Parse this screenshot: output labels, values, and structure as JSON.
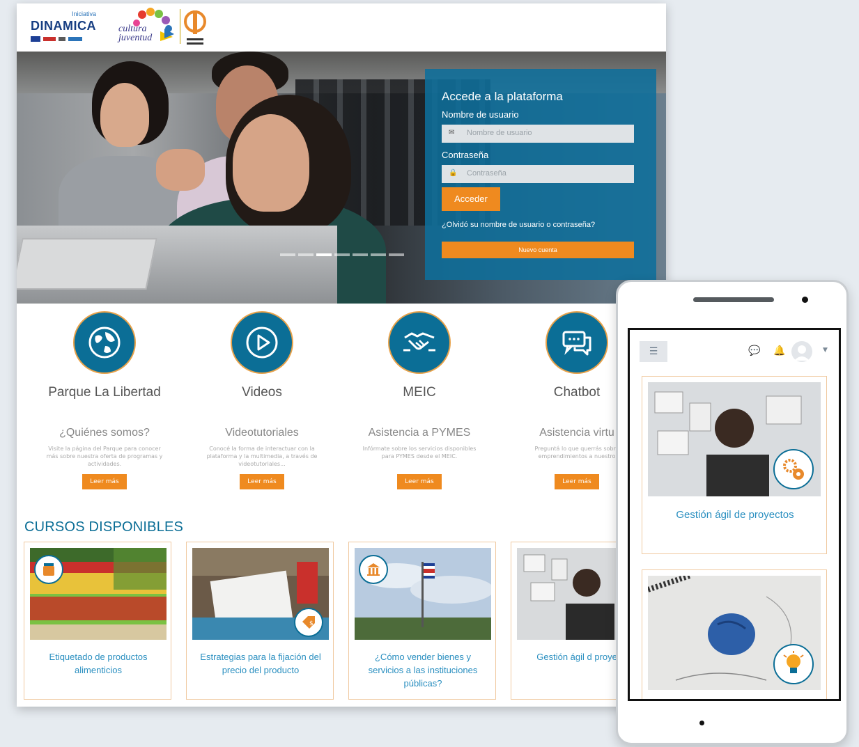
{
  "header": {
    "logo_dinamica_small": "Iniciativa",
    "logo_dinamica_big": "DINAMICA",
    "logo_cultura_line1": "cultura",
    "logo_cultura_line2": "juventud"
  },
  "login": {
    "title": "Accede a la plataforma",
    "username_label": "Nombre de usuario",
    "username_placeholder": "Nombre de usuario",
    "password_label": "Contraseña",
    "password_placeholder": "Contraseña",
    "submit_label": "Acceder",
    "forgot_text": "¿Olvidó su nombre de usuario o contraseña?",
    "new_account_label": "Nuevo cuenta"
  },
  "slider": {
    "slide_count": 7,
    "active_index": 2
  },
  "features": [
    {
      "title": "Parque La Libertad",
      "subtitle": "¿Quiénes somos?",
      "desc": "Visite la página del Parque para conocer más sobre nuestra oferta de programas y actividades.",
      "button": "Leer más",
      "icon": "globe-icon"
    },
    {
      "title": "Videos",
      "subtitle": "Videotutoriales",
      "desc": "Conocé la forma de interactuar con la plataforma y la multimedia, a través de videotutoriales...",
      "button": "Leer más",
      "icon": "play-icon"
    },
    {
      "title": "MEIC",
      "subtitle": "Asistencia a PYMES",
      "desc": "Infórmate sobre los servicios disponibles para PYMES desde el MEIC.",
      "button": "Leer más",
      "icon": "handshake-icon"
    },
    {
      "title": "Chatbot",
      "subtitle": "Asistencia virtu",
      "desc": "Preguntá lo que querrás sobre emprendimientos a nuestro",
      "button": "Leer más",
      "icon": "chat-icon"
    }
  ],
  "courses_heading": "CURSOS DISPONIBLES",
  "courses": [
    {
      "title": "Etiquetado de productos alimenticios",
      "badge_icon": "jar-icon"
    },
    {
      "title": "Estrategias para la fijación del precio del producto",
      "badge_icon": "price-tag-icon"
    },
    {
      "title": "¿Cómo vender bienes y servicios a las instituciones públicas?",
      "badge_icon": "institution-icon"
    },
    {
      "title": "Gestión ágil d proyectos",
      "badge_icon": ""
    }
  ],
  "mobile": {
    "menu_icon": "hamburger-icon",
    "cards": [
      {
        "title": "Gestión ágil de proyectos",
        "badge_icon": "gears-icon"
      },
      {
        "title": "",
        "badge_icon": "lightbulb-icon"
      }
    ]
  },
  "colors": {
    "brand_blue": "#0b6e96",
    "accent_orange": "#ef8a1f",
    "link_blue": "#2a8fc0"
  }
}
